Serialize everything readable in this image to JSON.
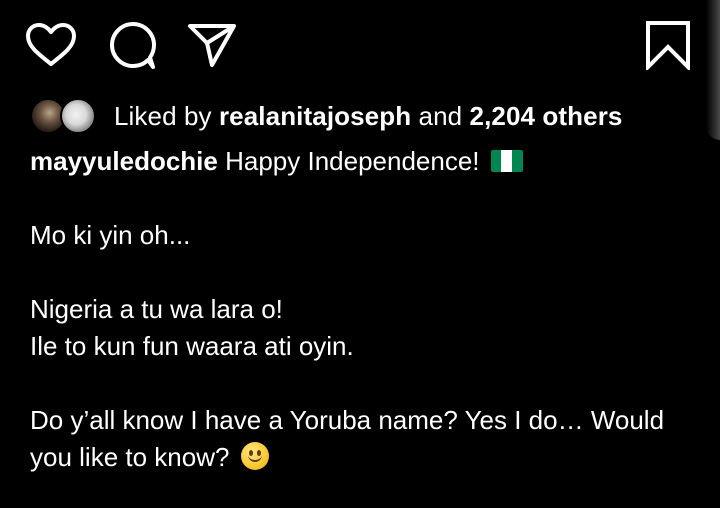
{
  "actions": {
    "like_icon": "heart-icon",
    "comment_icon": "comment-icon",
    "share_icon": "send-icon",
    "save_icon": "bookmark-icon"
  },
  "likes": {
    "prefix": "Liked by",
    "user": "realanitajoseph",
    "conjunction": "and",
    "count": "2,204 others"
  },
  "caption": {
    "username": "mayyuledochie",
    "first_line": "Happy Independence!",
    "flag_emoji": "nigeria-flag",
    "lines": [
      "Mo ki yin oh...",
      "Nigeria a tu wa lara o!",
      "Ile to kun fun waara ati oyin.",
      "Do y’all know I have a Yoruba name? Yes I do… Would you like to know?"
    ],
    "end_emoji": "smiley-emoji"
  },
  "colors": {
    "background": "#000000",
    "text": "#ffffff",
    "flag_green": "#008751",
    "flag_white": "#ffffff"
  }
}
